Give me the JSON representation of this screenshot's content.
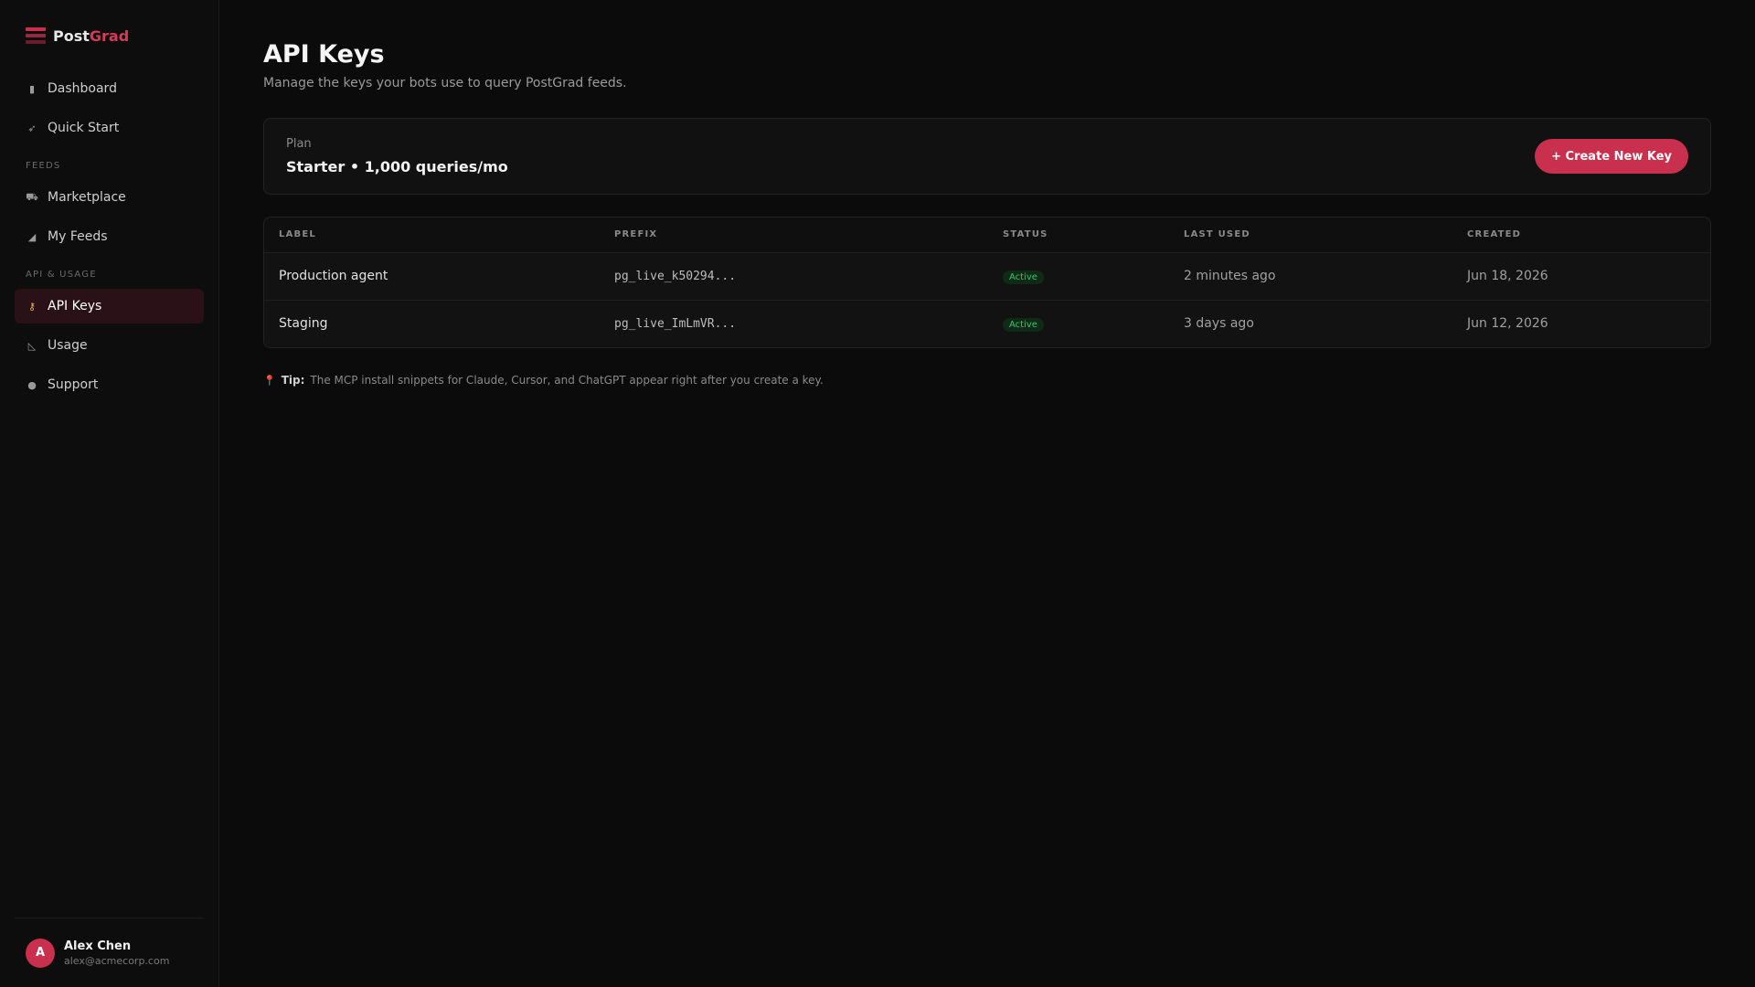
{
  "brand": {
    "name_part1": "Post",
    "name_part2": "Grad",
    "accent_color": "#c8304e"
  },
  "sidebar": {
    "items_top": [
      {
        "label": "Dashboard",
        "icon": "bar-chart-icon"
      },
      {
        "label": "Quick Start",
        "icon": "rocket-icon"
      }
    ],
    "section_feeds": "FEEDS",
    "items_feeds": [
      {
        "label": "Marketplace",
        "icon": "cart-icon"
      },
      {
        "label": "My Feeds",
        "icon": "satellite-icon"
      }
    ],
    "section_api": "API & USAGE",
    "items_api": [
      {
        "label": "API Keys",
        "icon": "key-icon",
        "active": true
      },
      {
        "label": "Usage",
        "icon": "line-chart-icon"
      },
      {
        "label": "Support",
        "icon": "chat-icon"
      }
    ]
  },
  "user": {
    "initial": "A",
    "name": "Alex Chen",
    "email": "alex@acmecorp.com"
  },
  "page": {
    "title": "API Keys",
    "subtitle": "Manage the keys your bots use to query PostGrad feeds."
  },
  "plan": {
    "label": "Plan",
    "value": "Starter • 1,000 queries/mo",
    "create_button": "+ Create New Key"
  },
  "table": {
    "headers": [
      "LABEL",
      "PREFIX",
      "STATUS",
      "LAST USED",
      "CREATED"
    ],
    "rows": [
      {
        "label": "Production agent",
        "prefix": "pg_live_k50294...",
        "status": "Active",
        "last_used": "2 minutes ago",
        "created": "Jun 18, 2026"
      },
      {
        "label": "Staging",
        "prefix": "pg_live_ImLmVR...",
        "status": "Active",
        "last_used": "3 days ago",
        "created": "Jun 12, 2026"
      }
    ]
  },
  "tip": {
    "prefix": "Tip:",
    "text": "The MCP install snippets for Claude, Cursor, and ChatGPT appear right after you create a key."
  }
}
